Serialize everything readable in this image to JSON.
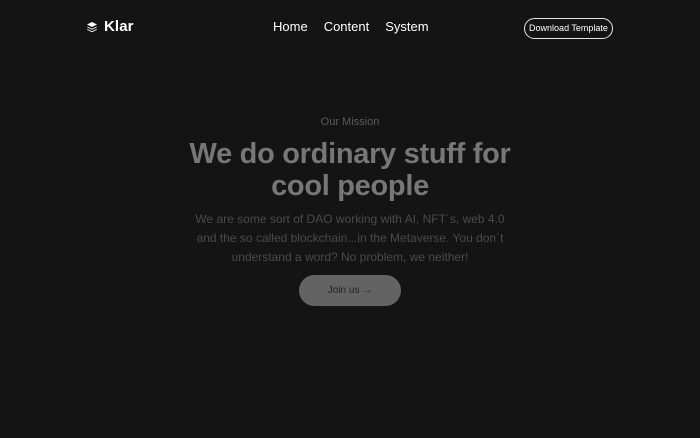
{
  "header": {
    "brand": "Klar",
    "brand_icon": "stack-layers-icon",
    "nav": [
      {
        "label": "Home"
      },
      {
        "label": "Content"
      },
      {
        "label": "System"
      }
    ],
    "cta_label": "Download Template"
  },
  "hero": {
    "eyebrow": "Our Mission",
    "headline": "We do ordinary stuff for cool people",
    "subtext": "We are some sort of DAO working with AI, NFT´s, web 4.0 and the so called blockchain...in the Metaverse. You don´t understand a word? No problem, we neither!",
    "button_label": "Join us →"
  },
  "colors": {
    "background": "#141414",
    "text_primary": "#ffffff",
    "headline": "#777777",
    "muted": "#4a4a4a",
    "button_bg": "#636363"
  }
}
